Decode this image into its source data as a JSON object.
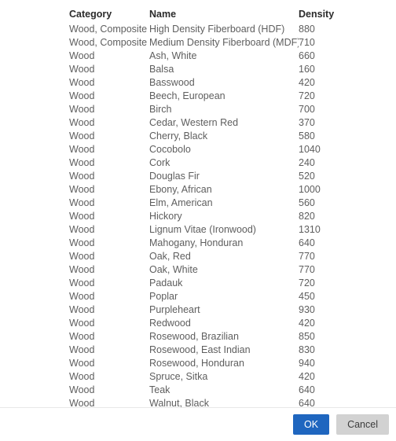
{
  "table": {
    "columns": [
      "Category",
      "Name",
      "Density"
    ],
    "rows": [
      [
        "Wood, Composite",
        "High Density Fiberboard (HDF)",
        "880"
      ],
      [
        "Wood, Composite",
        "Medium Density Fiberboard (MDF)",
        "710"
      ],
      [
        "Wood",
        "Ash, White",
        "660"
      ],
      [
        "Wood",
        "Balsa",
        "160"
      ],
      [
        "Wood",
        "Basswood",
        "420"
      ],
      [
        "Wood",
        "Beech, European",
        "720"
      ],
      [
        "Wood",
        "Birch",
        "700"
      ],
      [
        "Wood",
        "Cedar, Western Red",
        "370"
      ],
      [
        "Wood",
        "Cherry, Black",
        "580"
      ],
      [
        "Wood",
        "Cocobolo",
        "1040"
      ],
      [
        "Wood",
        "Cork",
        "240"
      ],
      [
        "Wood",
        "Douglas Fir",
        "520"
      ],
      [
        "Wood",
        "Ebony, African",
        "1000"
      ],
      [
        "Wood",
        "Elm, American",
        "560"
      ],
      [
        "Wood",
        "Hickory",
        "820"
      ],
      [
        "Wood",
        "Lignum Vitae (Ironwood)",
        "1310"
      ],
      [
        "Wood",
        "Mahogany, Honduran",
        "640"
      ],
      [
        "Wood",
        "Oak, Red",
        "770"
      ],
      [
        "Wood",
        "Oak, White",
        "770"
      ],
      [
        "Wood",
        "Padauk",
        "720"
      ],
      [
        "Wood",
        "Poplar",
        "450"
      ],
      [
        "Wood",
        "Purpleheart",
        "930"
      ],
      [
        "Wood",
        "Redwood",
        "420"
      ],
      [
        "Wood",
        "Rosewood, Brazilian",
        "850"
      ],
      [
        "Wood",
        "Rosewood, East Indian",
        "830"
      ],
      [
        "Wood",
        "Rosewood, Honduran",
        "940"
      ],
      [
        "Wood",
        "Spruce, Sitka",
        "420"
      ],
      [
        "Wood",
        "Teak",
        "640"
      ],
      [
        "Wood",
        "Walnut, Black",
        "640"
      ]
    ]
  },
  "footer": {
    "ok_label": "OK",
    "cancel_label": "Cancel"
  },
  "colors": {
    "primary_button": "#1f66bf",
    "secondary_button": "#d2d2d2",
    "header_text": "#2b2b2b",
    "body_text": "#5e5e5e",
    "separator": "#e8e8e8"
  }
}
